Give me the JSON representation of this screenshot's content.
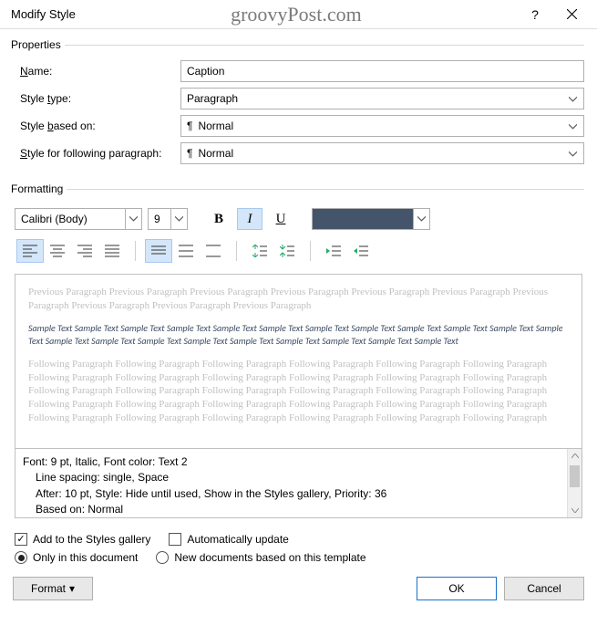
{
  "titlebar": {
    "title": "Modify Style",
    "watermark": "groovyPost.com",
    "help": "?"
  },
  "properties": {
    "legend": "Properties",
    "name_label": "Name:",
    "name_value": "Caption",
    "styletype_label": "Style type:",
    "styletype_value": "Paragraph",
    "basedon_label_pre": "Style ",
    "basedon_label_ul": "b",
    "basedon_label_post": "ased on:",
    "basedon_value": "Normal",
    "following_label_pre": "Style for following paragraph:",
    "following_value": "Normal"
  },
  "formatting": {
    "legend": "Formatting",
    "font": "Calibri (Body)",
    "size": "9",
    "bold": "B",
    "italic": "I",
    "underline": "U",
    "color": "#44546a"
  },
  "preview": {
    "prev": "Previous Paragraph Previous Paragraph Previous Paragraph Previous Paragraph Previous Paragraph Previous Paragraph Previous Paragraph Previous Paragraph Previous Paragraph Previous Paragraph",
    "sample": "Sample Text Sample Text Sample Text Sample Text Sample Text Sample Text Sample Text Sample Text Sample Text Sample Text Sample Text Sample Text Sample Text Sample Text Sample Text Sample Text Sample Text Sample Text Sample Text Sample Text Sample Text",
    "follow": "Following Paragraph Following Paragraph Following Paragraph Following Paragraph Following Paragraph Following Paragraph Following Paragraph Following Paragraph Following Paragraph Following Paragraph Following Paragraph Following Paragraph Following Paragraph Following Paragraph Following Paragraph Following Paragraph Following Paragraph Following Paragraph Following Paragraph Following Paragraph Following Paragraph Following Paragraph Following Paragraph Following Paragraph Following Paragraph Following Paragraph Following Paragraph Following Paragraph Following Paragraph Following Paragraph"
  },
  "desc": {
    "line1": "Font: 9 pt, Italic, Font color: Text 2",
    "line2": "Line spacing:  single, Space",
    "line3": "After:  10 pt, Style: Hide until used, Show in the Styles gallery, Priority: 36",
    "line4": "Based on: Normal"
  },
  "checks": {
    "addgallery_pre": "Add to the ",
    "addgallery_ul": "S",
    "addgallery_post": "tyles gallery",
    "autoupdate_pre": "A",
    "autoupdate_post": "utomatically update",
    "onlydoc": "Only in this document",
    "newdocs": "New documents based on this template"
  },
  "buttons": {
    "format_pre": "F",
    "format_ul": "o",
    "format_post": "rmat",
    "ok": "OK",
    "cancel": "Cancel"
  }
}
